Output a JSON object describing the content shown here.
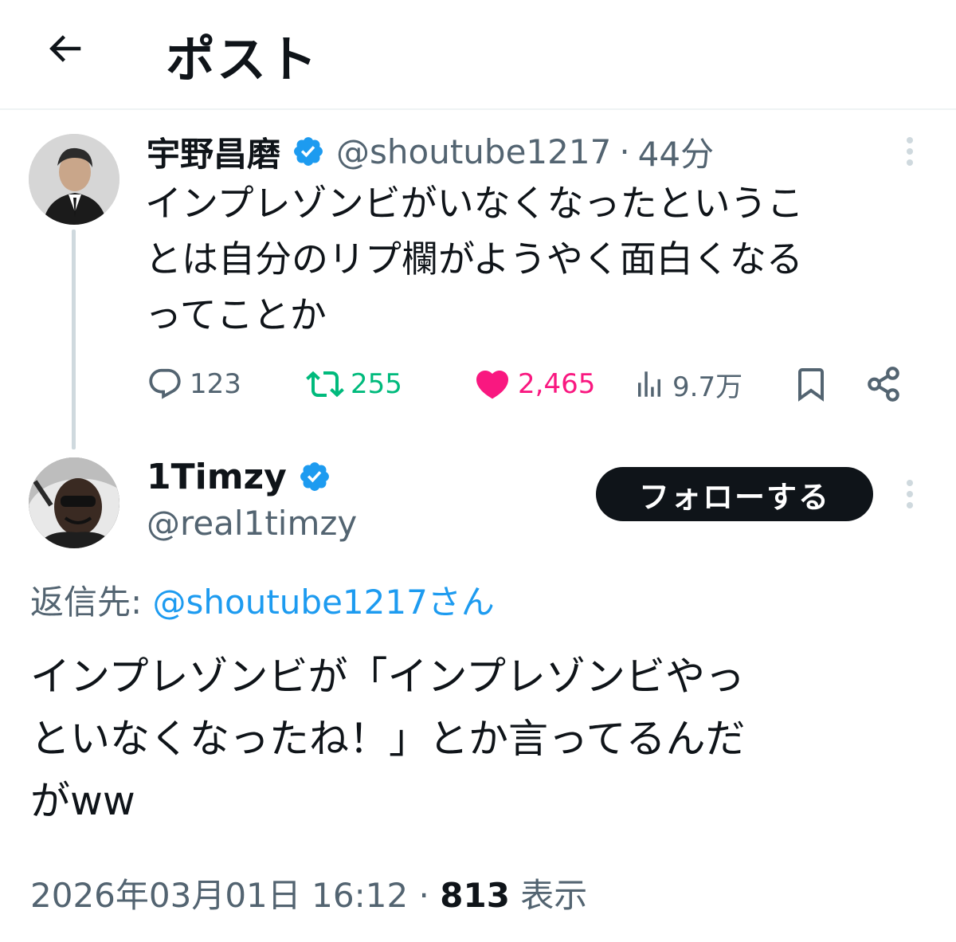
{
  "header": {
    "title": "ポスト"
  },
  "parent_post": {
    "author_name": "宇野昌磨",
    "handle": "@shoutube1217",
    "separator": "·",
    "time": "44分",
    "text_lines": [
      "インプレゾンビがいなくなったというこ",
      "とは自分のリプ欄がようやく面白くなる",
      "ってことか"
    ],
    "actions": {
      "replies": "123",
      "reposts": "255",
      "likes": "2,465",
      "views": "9.7万"
    },
    "colors": {
      "repost": "#00ba7c",
      "like": "#f91880"
    }
  },
  "reply_post": {
    "author_name": "1Timzy",
    "handle": "@real1timzy",
    "follow_label": "フォローする",
    "reply_to_label": "返信先:",
    "reply_to_mention": "@shoutube1217さん",
    "text_lines": [
      "インプレゾンビが「インプレゾンビやっ",
      "といなくなったね！」とか言ってるんだ",
      "がww"
    ],
    "date": "2026年03月01日 16:12",
    "separator": "·",
    "view_count": "813",
    "view_label": "表示"
  },
  "colors": {
    "accent": "#1d9bf0",
    "verified": "#1d9bf0",
    "secondary_text": "#536471"
  }
}
